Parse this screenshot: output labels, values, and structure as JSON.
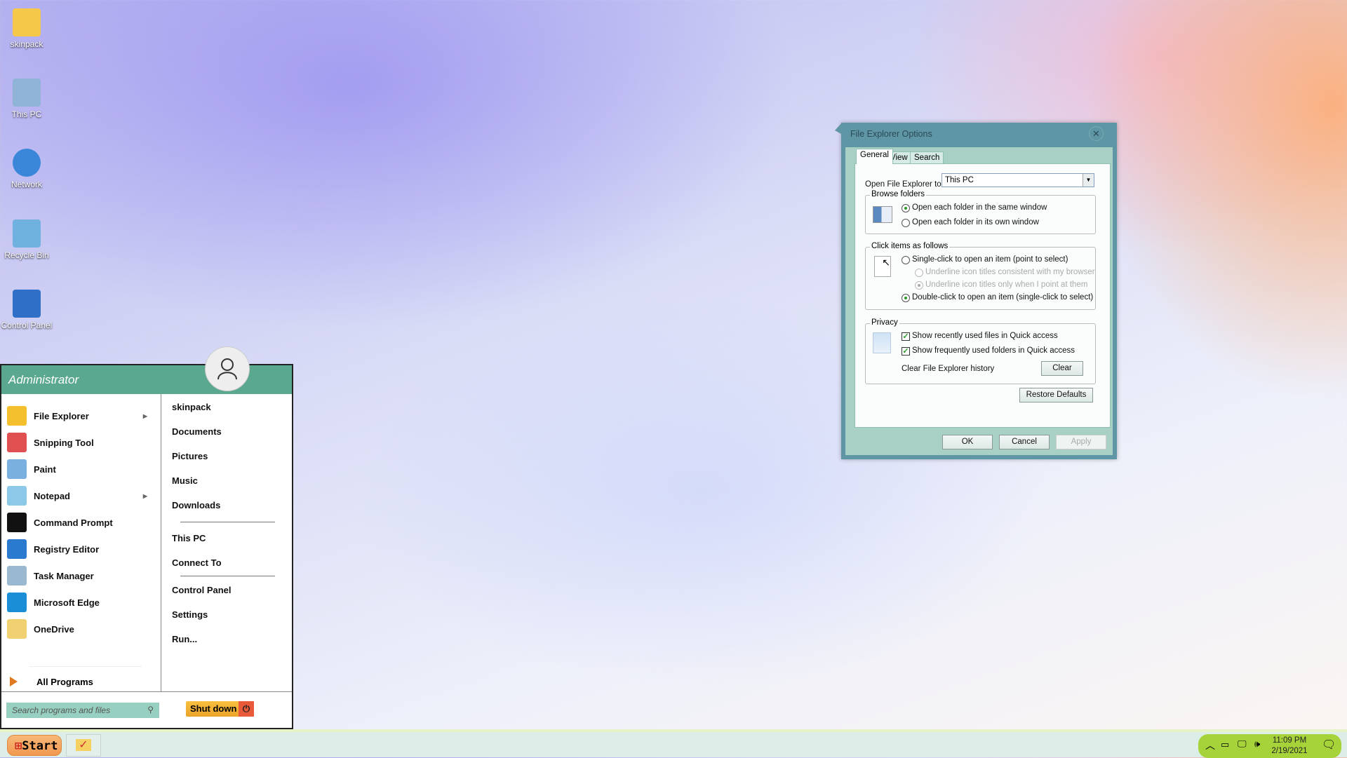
{
  "desktop": {
    "icons": [
      {
        "label": "skinpack",
        "color": "#f6c84a"
      },
      {
        "label": "This PC",
        "color": "#8fb4d8"
      },
      {
        "label": "Network",
        "color": "#3a86d8"
      },
      {
        "label": "Recycle Bin",
        "color": "#6fb2e0"
      },
      {
        "label": "Control Panel",
        "color": "#2f6fc8"
      }
    ]
  },
  "start_menu": {
    "user": "Administrator",
    "left_items": [
      {
        "label": "File Explorer",
        "icon": "folder-icon",
        "color": "#f4c02e",
        "submenu": true
      },
      {
        "label": "Snipping Tool",
        "icon": "scissors-icon",
        "color": "#e05050",
        "submenu": false
      },
      {
        "label": "Paint",
        "icon": "palette-icon",
        "color": "#7ab0e0",
        "submenu": false
      },
      {
        "label": "Notepad",
        "icon": "notepad-icon",
        "color": "#8cc8e8",
        "submenu": true
      },
      {
        "label": "Command Prompt",
        "icon": "terminal-icon",
        "color": "#111111",
        "submenu": false
      },
      {
        "label": "Registry Editor",
        "icon": "registry-icon",
        "color": "#2a7ad0",
        "submenu": false
      },
      {
        "label": "Task Manager",
        "icon": "task-manager-icon",
        "color": "#9ab8d0",
        "submenu": false
      },
      {
        "label": "Microsoft Edge",
        "icon": "edge-icon",
        "color": "#1a8fd8",
        "submenu": false
      },
      {
        "label": "OneDrive",
        "icon": "onedrive-icon",
        "color": "#f0d070",
        "submenu": false
      }
    ],
    "all_programs": "All Programs",
    "right_items": [
      "skinpack",
      "Documents",
      "Pictures",
      "Music",
      "Downloads",
      "This PC",
      "Connect To",
      "Control Panel",
      "Settings",
      "Run..."
    ],
    "search_placeholder": "Search programs and files",
    "shutdown": "Shut down"
  },
  "dialog": {
    "title": "File Explorer Options",
    "tabs": [
      "General",
      "View",
      "Search"
    ],
    "active_tab": "General",
    "open_to_label": "Open File Explorer to:",
    "open_to_value": "This PC",
    "browse": {
      "legend": "Browse folders",
      "options": [
        "Open each folder in the same window",
        "Open each folder in its own window"
      ],
      "selected": 0
    },
    "click": {
      "legend": "Click items as follows",
      "single": "Single-click to open an item (point to select)",
      "underline1": "Underline icon titles consistent with my browser",
      "underline2": "Underline icon titles only when I point at them",
      "double": "Double-click to open an item (single-click to select)",
      "selected": "double"
    },
    "privacy": {
      "legend": "Privacy",
      "recent": "Show recently used files in Quick access",
      "recent_checked": true,
      "frequent": "Show frequently used folders in Quick access",
      "frequent_checked": true,
      "clear_label": "Clear File Explorer history",
      "clear_button": "Clear"
    },
    "restore": "Restore Defaults",
    "ok": "OK",
    "cancel": "Cancel",
    "apply": "Apply"
  },
  "taskbar": {
    "start": "Start",
    "time": "11:09 PM",
    "date": "2/19/2021",
    "accent": "#a6d23a"
  }
}
